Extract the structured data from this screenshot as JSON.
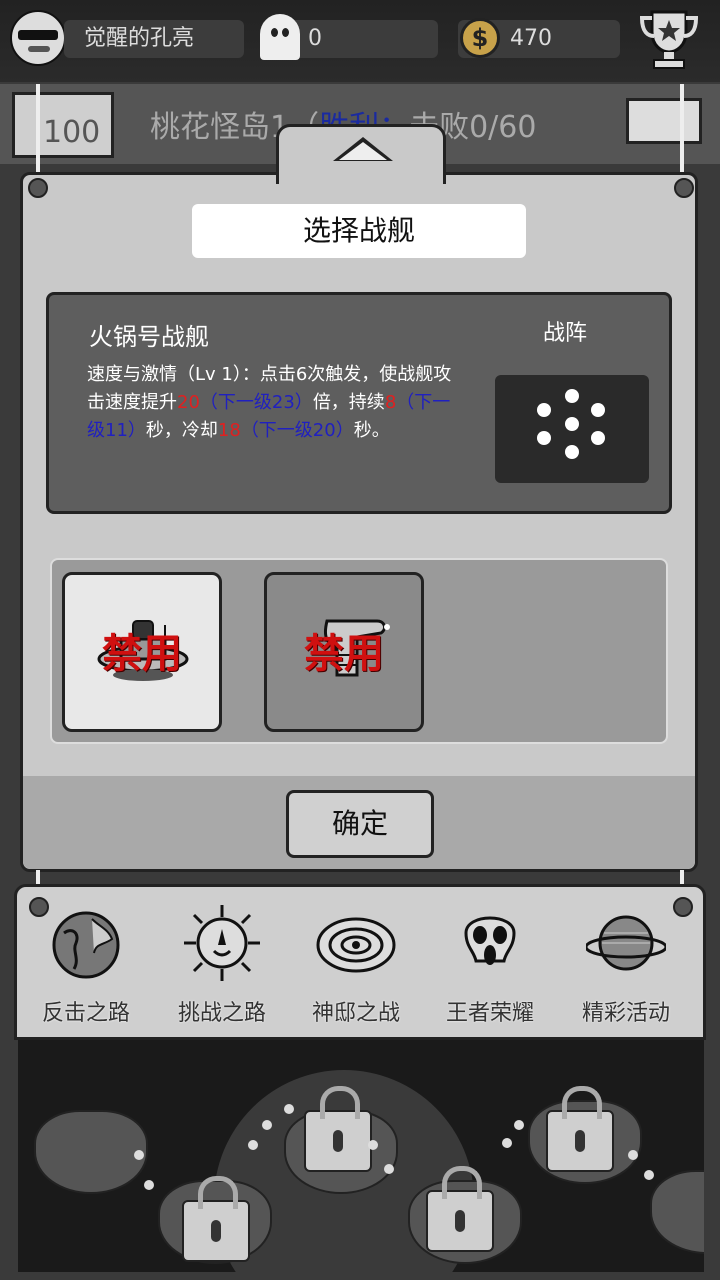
{
  "topbar": {
    "player_name": "觉醒的孔亮",
    "ghost_count": "0",
    "coin_icon": "$",
    "coin_count": "470"
  },
  "stage": {
    "number": "100",
    "title_prefix": "桃花怪岛1（",
    "title_status": "胜利：",
    "title_progress": "击败0/60"
  },
  "dialog": {
    "title": "选择战舰",
    "ship_name": "火锅号战舰",
    "formation_label": "战阵",
    "skill": {
      "p1": "速度与激情（Lv 1）：点击6次触发，使战舰攻击速度提升",
      "v1": "20",
      "n1": "（下一级23）",
      "p2": "倍，持续",
      "v2": "8",
      "n2": "（下一级11）",
      "p3": "秒，冷却",
      "v3": "18",
      "n3": "（下一级20）",
      "p4": "秒。"
    },
    "ships": [
      {
        "label": "禁用",
        "selected": true
      },
      {
        "label": "禁用",
        "selected": false
      }
    ],
    "confirm_label": "确定"
  },
  "nav": {
    "items": [
      {
        "label": "反击之路",
        "icon": "globe-icon"
      },
      {
        "label": "挑战之路",
        "icon": "sun-icon"
      },
      {
        "label": "神邸之战",
        "icon": "galaxy-icon"
      },
      {
        "label": "王者荣耀",
        "icon": "skull-icon"
      },
      {
        "label": "精彩活动",
        "icon": "planet-icon"
      }
    ]
  },
  "colors": {
    "highlight_red": "#e02020",
    "next_level_blue": "#2020c0",
    "ban_red": "#d01010"
  }
}
